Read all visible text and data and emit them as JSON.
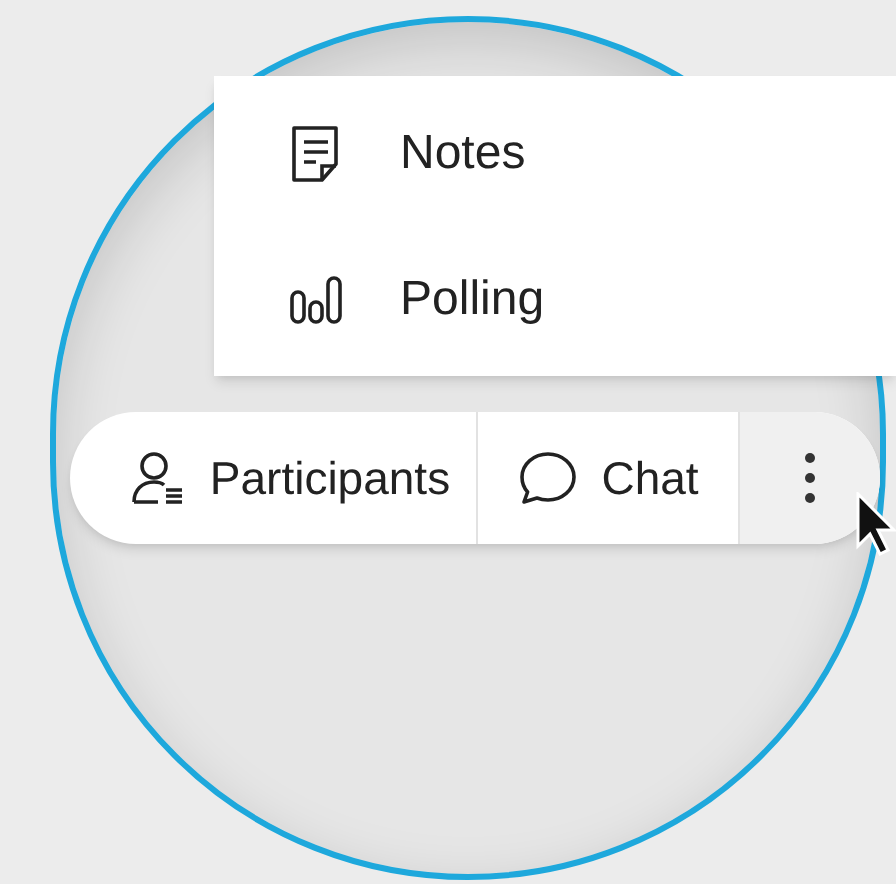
{
  "menu": {
    "items": [
      {
        "kind": "notes",
        "label": "Notes"
      },
      {
        "kind": "polling",
        "label": "Polling"
      }
    ]
  },
  "toolbar": {
    "buttons": [
      {
        "kind": "participants",
        "label": "Participants"
      },
      {
        "kind": "chat",
        "label": "Chat"
      },
      {
        "kind": "more"
      }
    ]
  }
}
